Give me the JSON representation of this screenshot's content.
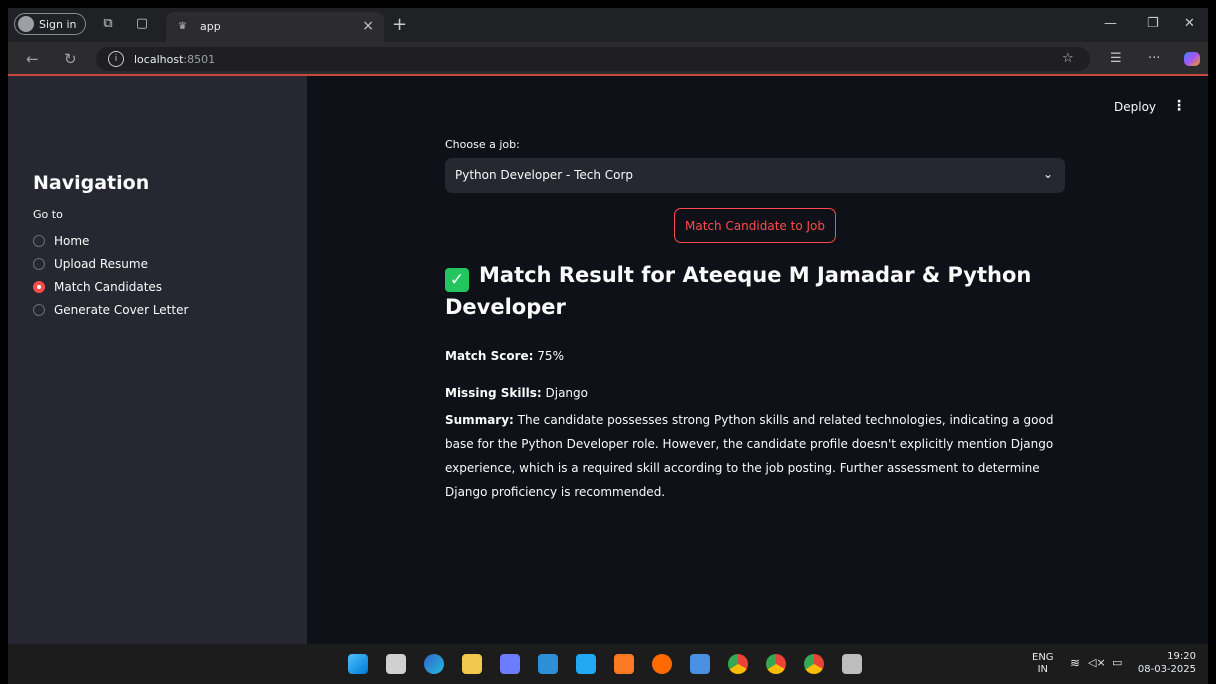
{
  "browser": {
    "signin_label": "Sign in",
    "tab_title": "app",
    "url_host": "localhost",
    "url_port": ":8501"
  },
  "sidebar": {
    "title": "Navigation",
    "goto_label": "Go to",
    "items": [
      {
        "label": "Home",
        "selected": false
      },
      {
        "label": "Upload Resume",
        "selected": false
      },
      {
        "label": "Match Candidates",
        "selected": true
      },
      {
        "label": "Generate Cover Letter",
        "selected": false
      }
    ]
  },
  "header": {
    "deploy_label": "Deploy"
  },
  "main": {
    "choose_label": "Choose a job:",
    "selected_job": "Python Developer - Tech Corp",
    "match_button": "Match Candidate to Job",
    "result_title": "Match Result for Ateeque M Jamadar & Python Developer",
    "score_label": "Match Score:",
    "score_value": "75%",
    "missing_label": "Missing Skills:",
    "missing_value": "Django",
    "summary_label": "Summary:",
    "summary_text": "The candidate possesses strong Python skills and related technologies, indicating a good base for the Python Developer role. However, the candidate profile doesn't explicitly mention Django experience, which is a required skill according to the job posting. Further assessment to determine Django proficiency is recommended."
  },
  "taskbar": {
    "lang_1": "ENG",
    "lang_2": "IN",
    "time": "19:20",
    "date": "08-03-2025"
  },
  "colors": {
    "accent": "#ff4b4b",
    "sidebar_bg": "#262730",
    "main_bg": "#0e1117",
    "check": "#22c55e"
  }
}
